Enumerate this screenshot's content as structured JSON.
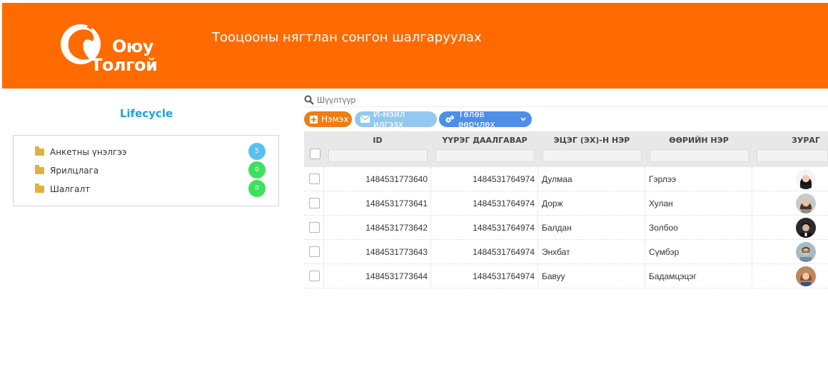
{
  "header": {
    "logo_line1": "Оюу",
    "logo_line2": "Толгой",
    "title": "Тооцооны нягтлан сонгон шалгаруулах"
  },
  "sidebar": {
    "title": "Lifecycle",
    "items": [
      {
        "label": "Анкетны үнэлгээ",
        "count": "5",
        "badge_color": "#5bc0f0"
      },
      {
        "label": "Ярилцлага",
        "count": "0",
        "badge_color": "#3ee05e"
      },
      {
        "label": "Шалгалт",
        "count": "0",
        "badge_color": "#3ee05e"
      }
    ]
  },
  "filter": {
    "placeholder": "Шүүлтүүр"
  },
  "toolbar": {
    "add_label": "Нэмэх",
    "email_label": "И-мэйл илгээх",
    "status_label": "Төлөв өөрчлөх"
  },
  "table": {
    "columns": [
      "ID",
      "ҮҮРЭГ ДААЛГАВАР",
      "ЭЦЭГ (ЭХ)-Н НЭР",
      "ӨӨРИЙН НЭР",
      "ЗУРАГ"
    ],
    "rows": [
      {
        "id": "1484531773640",
        "task": "1484531764974",
        "parent": "Дулмаа",
        "name": "Гэрлээ"
      },
      {
        "id": "1484531773641",
        "task": "1484531764974",
        "parent": "Дорж",
        "name": "Хулан"
      },
      {
        "id": "1484531773642",
        "task": "1484531764974",
        "parent": "Балдан",
        "name": "Золбоо"
      },
      {
        "id": "1484531773643",
        "task": "1484531764974",
        "parent": "Энхбат",
        "name": "Сүмбэр"
      },
      {
        "id": "1484531773644",
        "task": "1484531764974",
        "parent": "Бавуу",
        "name": "Бадамцэцэг"
      }
    ]
  },
  "colors": {
    "brand_orange": "#ff6b00",
    "accent_blue": "#1fa3dc"
  }
}
